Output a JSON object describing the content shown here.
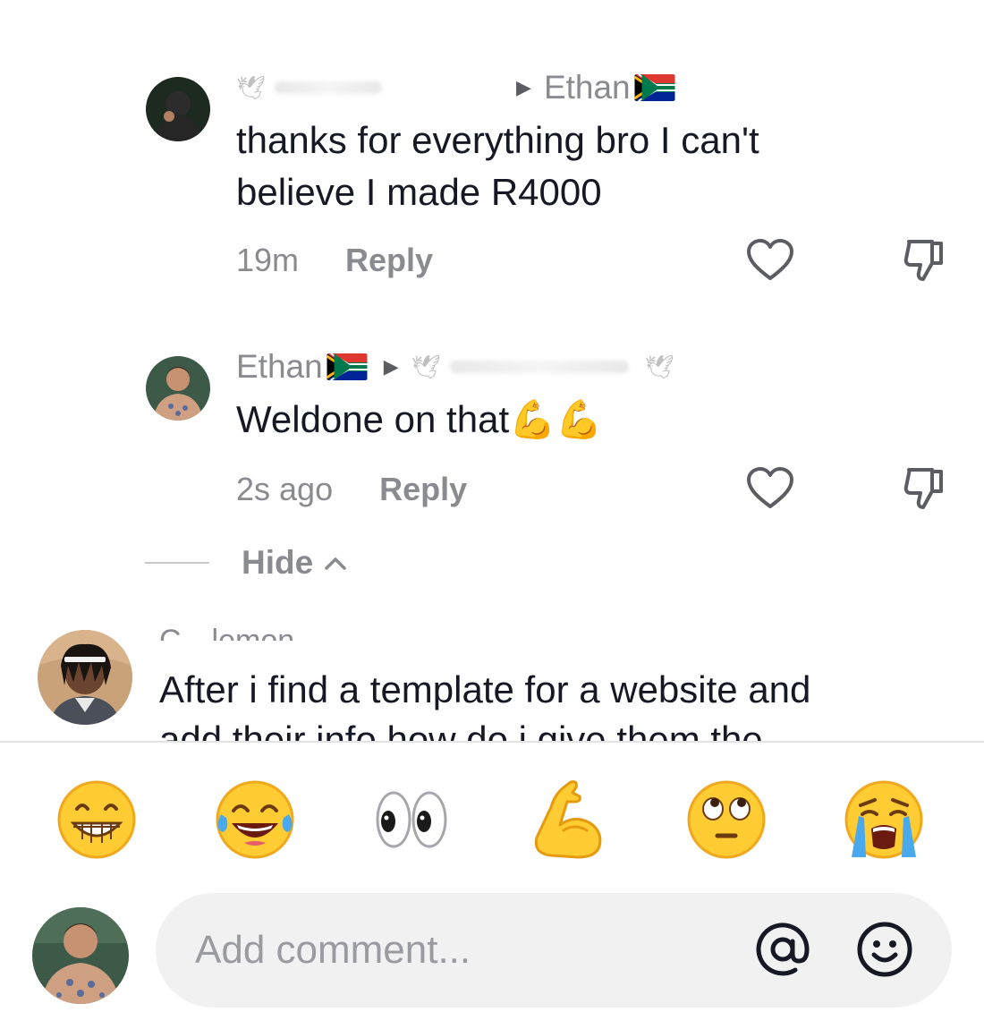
{
  "comments": [
    {
      "id": "reply-1",
      "author": "",
      "reply_to": "Ethan",
      "text": "thanks for everything bro I can't believe I made R4000",
      "time": "19m",
      "reply_label": "Reply",
      "avatar_icon": "dark-portrait-avatar"
    },
    {
      "id": "reply-2",
      "author": "Ethan",
      "reply_to": "",
      "text": "Weldone on that💪💪",
      "time": "2s ago",
      "reply_label": "Reply",
      "avatar_icon": "shirtless-portrait-avatar"
    }
  ],
  "thread_toggle": {
    "label": "Hide"
  },
  "top_comment": {
    "author": "C…lemon",
    "text_line1": "After i find a template for a website and",
    "text_line2": "add their info how do i give them the",
    "avatar_icon": "anime-portrait-avatar"
  },
  "quick_emojis": [
    "grinning-face",
    "tears-of-joy-face",
    "eyes",
    "flexed-biceps",
    "rolling-eyes-face",
    "loudly-crying-face"
  ],
  "composer": {
    "placeholder": "Add comment...",
    "mention_icon": "at-sign-icon",
    "emoji_icon": "smiley-icon"
  },
  "colors": {
    "text": "#161823",
    "muted": "#8a8b91",
    "pill_bg": "#f1f1f2",
    "emoji_yellow": "#ffcc33"
  }
}
